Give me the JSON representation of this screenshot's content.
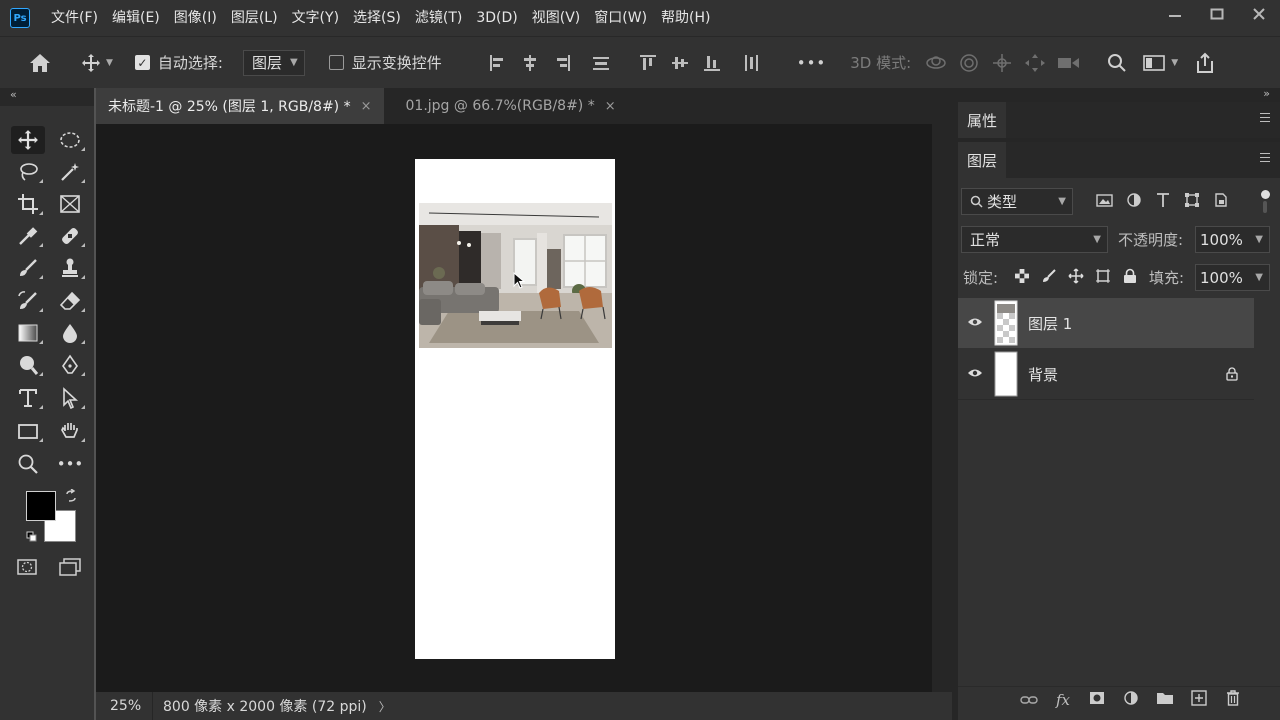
{
  "app": {
    "logo": "Ps"
  },
  "menu": [
    "文件(F)",
    "编辑(E)",
    "图像(I)",
    "图层(L)",
    "文字(Y)",
    "选择(S)",
    "滤镜(T)",
    "3D(D)",
    "视图(V)",
    "窗口(W)",
    "帮助(H)"
  ],
  "options": {
    "auto_select_label": "自动选择:",
    "auto_select_checked": true,
    "auto_select_target": "图层",
    "show_transform_label": "显示变换控件",
    "show_transform_checked": false,
    "more": "•••",
    "mode_3d_label": "3D 模式:"
  },
  "tabs": [
    {
      "label": "未标题-1 @ 25% (图层 1, RGB/8#) *",
      "active": true
    },
    {
      "label": "01.jpg @ 66.7%(RGB/8#) *",
      "active": false
    }
  ],
  "status": {
    "zoom": "25%",
    "doc_info": "800 像素 x 2000 像素 (72 ppi)",
    "arrow": "〉"
  },
  "panels": {
    "properties_title": "属性",
    "layers_title": "图层",
    "filter_kind": "类型",
    "blend_mode": "正常",
    "opacity_label": "不透明度:",
    "opacity_value": "100%",
    "lock_label": "锁定:",
    "fill_label": "填充:",
    "fill_value": "100%",
    "layers": [
      {
        "name": "图层 1",
        "selected": true,
        "locked": false
      },
      {
        "name": "背景",
        "selected": false,
        "locked": true
      }
    ]
  },
  "colors": {
    "foreground": "#000000",
    "background": "#ffffff",
    "ps_blue": "#31a8ff"
  }
}
